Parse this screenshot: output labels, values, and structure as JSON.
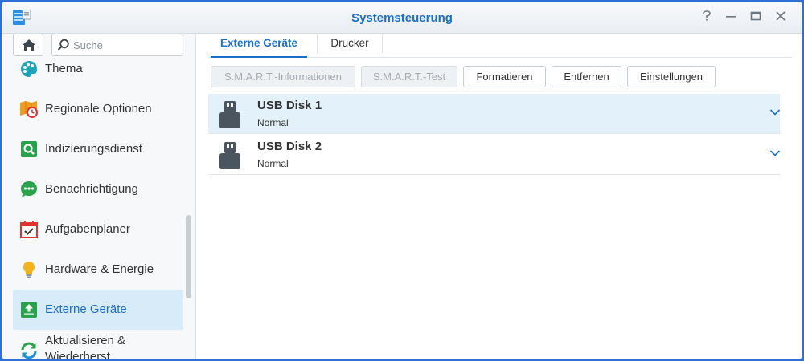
{
  "window": {
    "title": "Systemsteuerung",
    "buttons": [
      "?",
      "minimize",
      "maximize",
      "close"
    ]
  },
  "sidebar": {
    "search_placeholder": "Suche",
    "items": [
      {
        "label": "Thema",
        "icon": "palette-icon"
      },
      {
        "label": "Regionale Optionen",
        "icon": "map-clock-icon"
      },
      {
        "label": "Indizierungsdienst",
        "icon": "search-index-icon"
      },
      {
        "label": "Benachrichtigung",
        "icon": "chat-bubble-icon"
      },
      {
        "label": "Aufgabenplaner",
        "icon": "calendar-check-icon"
      },
      {
        "label": "Hardware & Energie",
        "icon": "lightbulb-icon"
      },
      {
        "label": "Externe Geräte",
        "icon": "external-device-icon",
        "active": true
      },
      {
        "label": "Aktualisieren & Wiederherst.",
        "icon": "refresh-icon"
      }
    ]
  },
  "main": {
    "tabs": [
      {
        "label": "Externe Geräte",
        "active": true
      },
      {
        "label": "Drucker",
        "active": false
      }
    ],
    "toolbar": {
      "smart_info": "S.M.A.R.T.-Informationen",
      "smart_test": "S.M.A.R.T.-Test",
      "format": "Formatieren",
      "remove": "Entfernen",
      "settings": "Einstellungen"
    },
    "devices": [
      {
        "name": "USB Disk 1",
        "status": "Normal",
        "selected": true
      },
      {
        "name": "USB Disk 2",
        "status": "Normal",
        "selected": false
      }
    ]
  },
  "colors": {
    "accent": "#1c6fc6",
    "selected_row": "#e3f1fb",
    "active_nav": "#d7ebf9"
  }
}
